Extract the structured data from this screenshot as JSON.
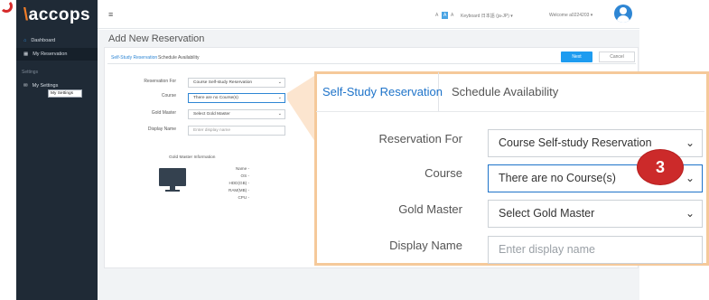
{
  "sidebar": {
    "logo": "accops",
    "items": [
      {
        "label": "Dashboard"
      },
      {
        "label": "My Reservation"
      }
    ],
    "section_label": "Settings",
    "settings_item": {
      "label": "My Settings"
    },
    "tooltip": "My Settings"
  },
  "topbar": {
    "menu_icon": "≡",
    "font_sizes": [
      "A",
      "A",
      "A"
    ],
    "keyboard": "Keyboard 日本語 (ja-JP) ▾",
    "welcome": "Welcome a0224203 ▾"
  },
  "page": {
    "title": "Add New Reservation",
    "tabs": [
      "Self-Study Reservation",
      "Schedule Availability"
    ],
    "next_label": "Next",
    "cancel_label": "Cancel"
  },
  "form": {
    "reservation_for_label": "Reservation For",
    "reservation_for_value": "Course Self-study Reservation",
    "course_label": "Course",
    "course_value": "There are no Course(s)",
    "gold_master_label": "Gold Master",
    "gold_master_value": "Select Gold Master",
    "display_name_label": "Display Name",
    "display_name_placeholder": "Enter display name"
  },
  "gold_master_info": {
    "title": "Gold Master Information",
    "rows": [
      "Name -",
      "OS -",
      "HDD(GB) -",
      "RAM(MB) -",
      "CPU -"
    ]
  },
  "zoom": {
    "tabs": [
      "Self-Study Reservation",
      "Schedule Availability"
    ],
    "reservation_for_label": "Reservation For",
    "reservation_for_value": "Course Self-study Reservation",
    "course_label": "Course",
    "course_value": "There are no Course(s)",
    "gold_master_label": "Gold Master",
    "gold_master_value": "Select Gold Master",
    "display_name_label": "Display Name",
    "display_name_placeholder": "Enter display name",
    "step_number": "3"
  },
  "colors": {
    "sidebar_bg": "#1f2a36",
    "accent": "#1e9cf0",
    "brand_orange": "#f07d28",
    "step_badge": "#cc2a2a",
    "callout_border": "#f5c99a"
  }
}
